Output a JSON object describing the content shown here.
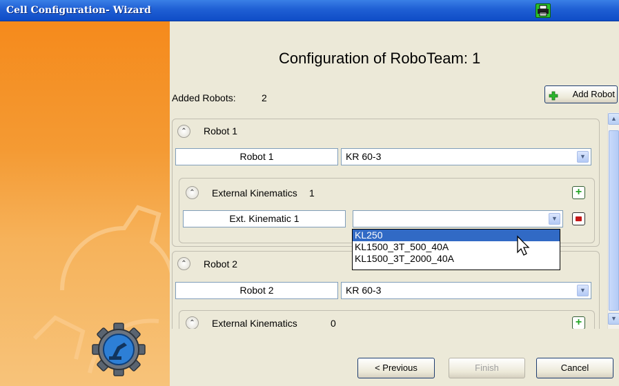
{
  "window": {
    "title": "Cell Configuration- Wizard"
  },
  "main": {
    "heading": "Configuration of RoboTeam: 1",
    "added_label": "Added Robots:",
    "added_count": "2",
    "add_robot_label": "Add Robot"
  },
  "robots": [
    {
      "header": "Robot 1",
      "name": "Robot 1",
      "model": "KR 60-3",
      "ext_label": "External Kinematics",
      "ext_count": "1",
      "ext_kinematics": [
        {
          "name": "Ext. Kinematic 1",
          "value": ""
        }
      ]
    },
    {
      "header": "Robot 2",
      "name": "Robot 2",
      "model": "KR 60-3",
      "ext_label": "External Kinematics",
      "ext_count": "0"
    }
  ],
  "dropdown": {
    "options": [
      "KL250",
      "KL1500_3T_500_40A",
      "KL1500_3T_2000_40A"
    ],
    "selected": "KL250"
  },
  "footer": {
    "previous": "< Previous",
    "finish": "Finish",
    "cancel": "Cancel"
  },
  "colors": {
    "titlebar": "#1f5fd4",
    "sidebar": "#f49a33",
    "selection": "#316ac5"
  },
  "icons": [
    "printer-icon",
    "gear-robot-icon",
    "plus-icon",
    "delete-icon",
    "chevron-up-icon",
    "chevron-down-icon"
  ]
}
